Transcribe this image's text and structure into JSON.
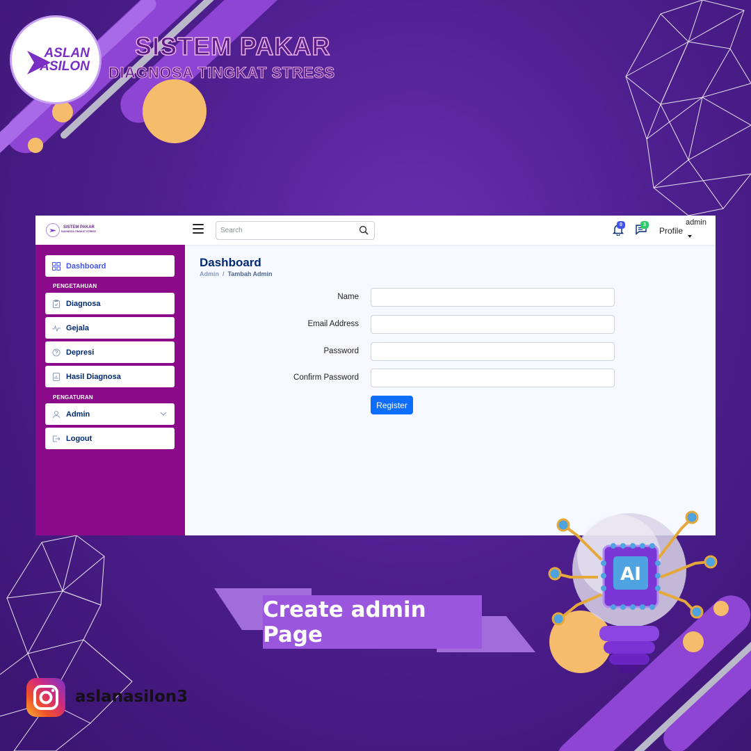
{
  "brand": {
    "logo_line1": "ASLAN",
    "logo_line2": "ASILON",
    "title": "SISTEM PAKAR",
    "subtitle": "DIAGNOSA TINGKAT STRESS"
  },
  "app": {
    "mini_title": "SISTEM PAKAR",
    "mini_subtitle": "DIAGNOSA TINGKAT STRESS",
    "search_placeholder": "Search",
    "notifications_count": "0",
    "messages_count": "3",
    "profile_label": "Profile",
    "user_name": "admin",
    "sidebar": {
      "dashboard": "Dashboard",
      "section_knowledge": "PENGETAHUAN",
      "diagnosa": "Diagnosa",
      "gejala": "Gejala",
      "depresi": "Depresi",
      "hasil_diagnosa": "Hasil Diagnosa",
      "section_settings": "PENGATURAN",
      "admin": "Admin",
      "logout": "Logout"
    },
    "page_title": "Dashboard",
    "breadcrumb": [
      "Admin",
      "Tambah Admin"
    ],
    "form": {
      "name_label": "Name",
      "email_label": "Email Address",
      "password_label": "Password",
      "confirm_label": "Confirm Password",
      "register_button": "Register"
    }
  },
  "banner": {
    "text": "Create admin Page"
  },
  "social": {
    "icon": "instagram-icon",
    "handle": "aslanasilon3"
  },
  "colors": {
    "background": "#4e1f8f",
    "sidebar": "#8b0a89",
    "primary_button": "#0d6efd",
    "banner": "#9a57dd",
    "accent_circle": "#f5bd6b"
  }
}
